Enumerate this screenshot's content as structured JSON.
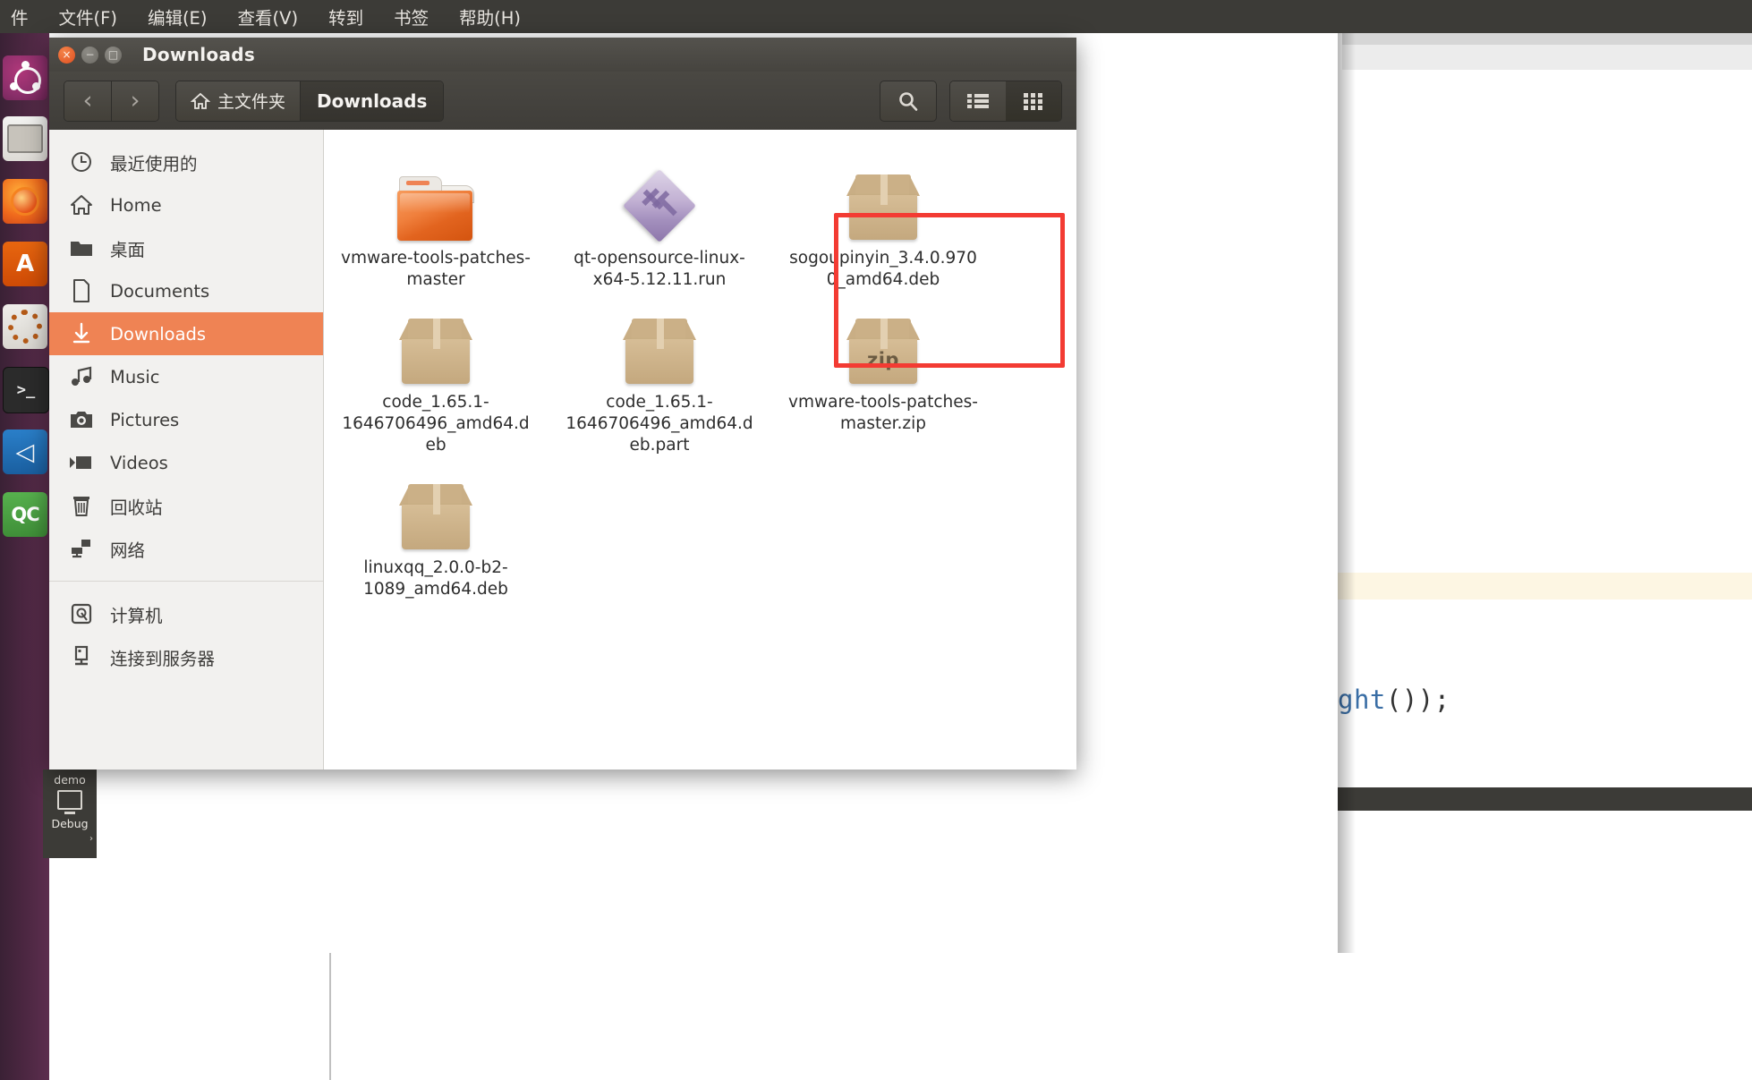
{
  "panel": {
    "menus": [
      "件",
      "文件(F)",
      "编辑(E)",
      "查看(V)",
      "转到",
      "书签",
      "帮助(H)"
    ]
  },
  "launcher": {
    "items": [
      {
        "name": "ubuntu-dash-icon",
        "label": "Ubuntu"
      },
      {
        "name": "files-icon",
        "label": "Files"
      },
      {
        "name": "firefox-icon",
        "label": "Firefox"
      },
      {
        "name": "amazon-icon",
        "label": "A"
      },
      {
        "name": "settings-icon",
        "label": "Settings"
      },
      {
        "name": "terminal-icon",
        "label": ">_"
      },
      {
        "name": "vscode-icon",
        "label": "◁"
      },
      {
        "name": "qtcreator-icon",
        "label": "QC"
      }
    ],
    "demo_tile": {
      "title": "demo",
      "subtitle": "Debug"
    }
  },
  "window": {
    "title": "Downloads",
    "buttons": {
      "close": "×",
      "minimize": "−",
      "maximize": "□"
    }
  },
  "toolbar": {
    "back": "‹",
    "forward": "›",
    "breadcrumb_home": "主文件夹",
    "breadcrumb_current": "Downloads",
    "search": "search-icon",
    "list_view": "list-view-icon",
    "grid_view": "grid-view-icon"
  },
  "sidebar": {
    "items": [
      {
        "label": "最近使用的",
        "icon": "clock-icon",
        "selected": false
      },
      {
        "label": "Home",
        "icon": "home-icon",
        "selected": false
      },
      {
        "label": "桌面",
        "icon": "folder-icon",
        "selected": false
      },
      {
        "label": "Documents",
        "icon": "document-icon",
        "selected": false
      },
      {
        "label": "Downloads",
        "icon": "download-arrow-icon",
        "selected": true
      },
      {
        "label": "Music",
        "icon": "music-note-icon",
        "selected": false
      },
      {
        "label": "Pictures",
        "icon": "camera-icon",
        "selected": false
      },
      {
        "label": "Videos",
        "icon": "video-camera-icon",
        "selected": false
      },
      {
        "label": "回收站",
        "icon": "trash-icon",
        "selected": false
      },
      {
        "label": "网络",
        "icon": "network-icon",
        "selected": false
      }
    ],
    "items2": [
      {
        "label": "计算机",
        "icon": "harddisk-icon"
      },
      {
        "label": "连接到服务器",
        "icon": "server-connect-icon"
      }
    ]
  },
  "files": {
    "rows": [
      [
        {
          "name": "vmware-tools-patches-master",
          "type": "folder"
        },
        {
          "name": "qt-opensource-linux-x64-5.12.11.run",
          "type": "run"
        },
        {
          "name": "sogoupinyin_3.4.0.9700_amd64.deb",
          "type": "deb"
        }
      ],
      [
        {
          "name": "code_1.65.1-1646706496_amd64.deb",
          "type": "deb"
        },
        {
          "name": "code_1.65.1-1646706496_amd64.deb.part",
          "type": "deb"
        },
        {
          "name": "vmware-tools-patches-master.zip",
          "type": "zip",
          "badge": "zip"
        }
      ],
      [
        {
          "name": "linuxqq_2.0.0-b2-1089_amd64.deb",
          "type": "deb"
        }
      ]
    ]
  },
  "annotation": {
    "color": "#f33b33",
    "target": "qt-opensource-linux-x64-5.12.11.run"
  },
  "editor": {
    "code_text": "ght",
    "code_punct": "());"
  },
  "colors": {
    "accent": "#ef8354",
    "titlebar": "#46443f",
    "launcher": "#5c2e4e"
  }
}
